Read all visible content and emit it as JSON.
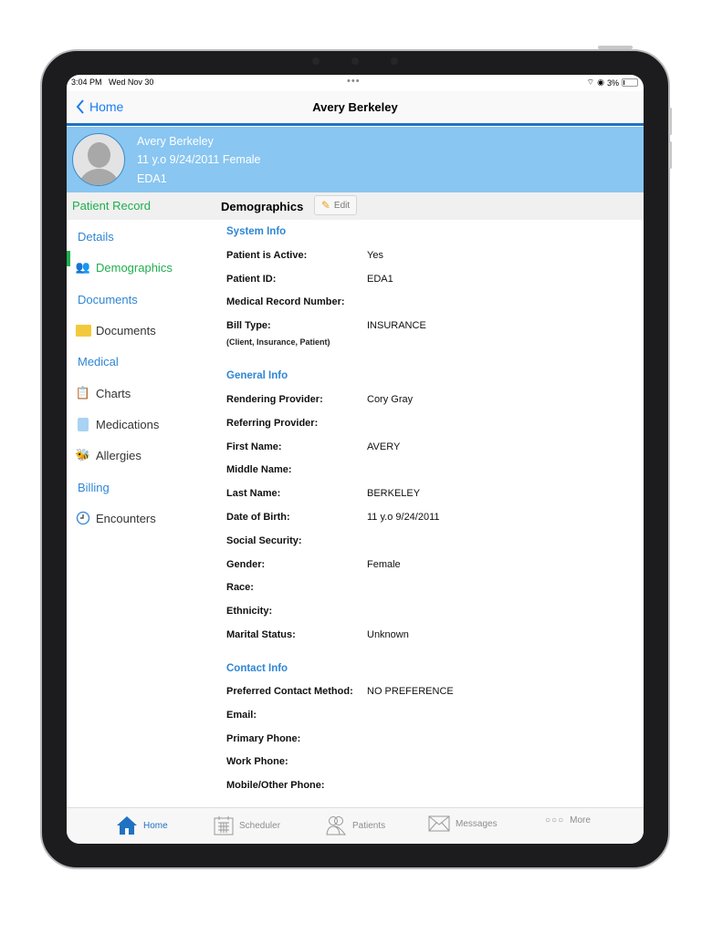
{
  "status": {
    "time": "3:04 PM",
    "date": "Wed Nov 30",
    "battery": "3%"
  },
  "nav": {
    "back": "Home",
    "title": "Avery Berkeley"
  },
  "patient": {
    "name": "Avery Berkeley",
    "age_dob_gender": "11 y.o  9/24/2011 Female",
    "id": "EDA1"
  },
  "subbar": {
    "record": "Patient Record",
    "section": "Demographics",
    "edit": "Edit"
  },
  "sidebar": [
    {
      "label": "Details",
      "type": "section"
    },
    {
      "label": "Demographics",
      "type": "item",
      "icon": "people-icon",
      "active": true
    },
    {
      "label": "Documents",
      "type": "section"
    },
    {
      "label": "Documents",
      "type": "item",
      "icon": "folder-icon"
    },
    {
      "label": "Medical",
      "type": "section"
    },
    {
      "label": "Charts",
      "type": "item",
      "icon": "clipboard-icon"
    },
    {
      "label": "Medications",
      "type": "item",
      "icon": "medication-icon"
    },
    {
      "label": "Allergies",
      "type": "item",
      "icon": "bee-icon"
    },
    {
      "label": "Billing",
      "type": "section"
    },
    {
      "label": "Encounters",
      "type": "item",
      "icon": "clock-icon"
    }
  ],
  "system_info": {
    "title": "System Info",
    "rows": [
      {
        "label": "Patient is Active:",
        "value": "Yes"
      },
      {
        "label": "Patient ID:",
        "value": "EDA1"
      },
      {
        "label": "Medical Record Number:",
        "value": ""
      },
      {
        "label": "Bill Type:",
        "value": "INSURANCE"
      }
    ],
    "bill_hint": "(Client, Insurance, Patient)"
  },
  "general_info": {
    "title": "General Info",
    "rows": [
      {
        "label": "Rendering Provider:",
        "value": "Cory Gray"
      },
      {
        "label": "Referring Provider:",
        "value": ""
      },
      {
        "label": "First Name:",
        "value": "AVERY"
      },
      {
        "label": "Middle Name:",
        "value": ""
      },
      {
        "label": "Last Name:",
        "value": "BERKELEY"
      },
      {
        "label": "Date of Birth:",
        "value": "11 y.o  9/24/2011"
      },
      {
        "label": "Social Security:",
        "value": ""
      },
      {
        "label": "Gender:",
        "value": "Female"
      },
      {
        "label": "Race:",
        "value": ""
      },
      {
        "label": "Ethnicity:",
        "value": ""
      },
      {
        "label": "Marital Status:",
        "value": "Unknown"
      }
    ]
  },
  "contact_info": {
    "title": "Contact Info",
    "rows": [
      {
        "label": "Preferred Contact Method:",
        "value": "NO PREFERENCE"
      },
      {
        "label": "Email:",
        "value": ""
      },
      {
        "label": "Primary Phone:",
        "value": ""
      },
      {
        "label": "Work Phone:",
        "value": ""
      },
      {
        "label": "Mobile/Other Phone:",
        "value": ""
      }
    ]
  },
  "tabs": [
    {
      "label": "Home",
      "active": true
    },
    {
      "label": "Scheduler"
    },
    {
      "label": "Patients"
    },
    {
      "label": "Messages"
    },
    {
      "label": "More"
    }
  ],
  "colors": {
    "accent": "#1f72c1",
    "banner": "#89c6f1",
    "active": "#1fae4e",
    "section": "#2f86d4"
  }
}
